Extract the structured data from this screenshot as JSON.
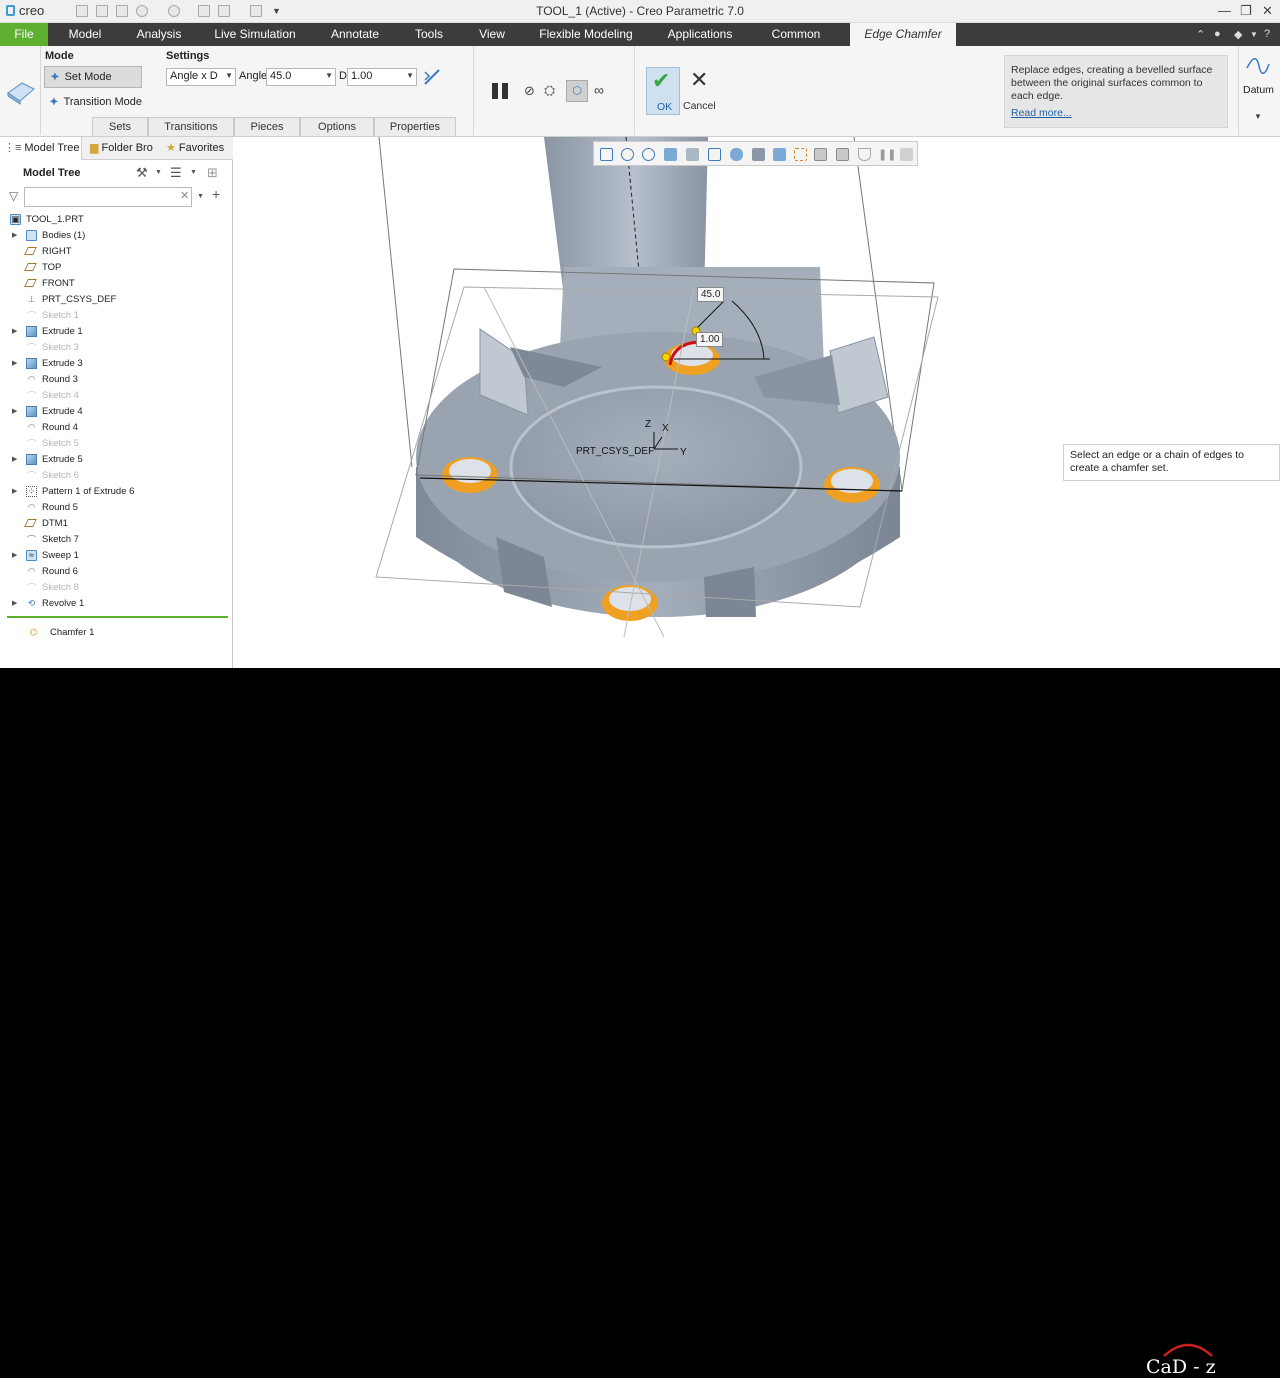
{
  "titlebar": {
    "logo": "creo",
    "title": "TOOL_1 (Active) - Creo Parametric 7.0"
  },
  "ribbon_tabs": [
    "File",
    "Model",
    "Analysis",
    "Live Simulation",
    "Annotate",
    "Tools",
    "View",
    "Flexible Modeling",
    "Applications",
    "Common",
    "Edge Chamfer"
  ],
  "ribbon": {
    "mode_label": "Mode",
    "settings_label": "Settings",
    "set_mode": "Set Mode",
    "transition_mode": "Transition Mode",
    "dim_scheme": "Angle x D",
    "angle_label": "Angle",
    "angle_value": "45.0",
    "d_label": "D",
    "d_value": "1.00",
    "ok_label": "OK",
    "cancel_label": "Cancel",
    "subtabs": [
      "Sets",
      "Transitions",
      "Pieces",
      "Options",
      "Properties"
    ],
    "help_text": "Replace edges, creating a bevelled surface between the original surfaces common to each edge.",
    "read_more": "Read more...",
    "datum_label": "Datum"
  },
  "left_panel": {
    "tabs": [
      "Model Tree",
      "Folder Bro",
      "Favorites"
    ],
    "header": "Model Tree",
    "tree": [
      {
        "label": "TOOL_1.PRT",
        "icon": "part-icon",
        "dim": false,
        "expand": false
      },
      {
        "label": "Bodies (1)",
        "icon": "body-icon",
        "dim": false,
        "expand": true
      },
      {
        "label": "RIGHT",
        "icon": "datum-plane-icon",
        "dim": false,
        "expand": false
      },
      {
        "label": "TOP",
        "icon": "datum-plane-icon",
        "dim": false,
        "expand": false
      },
      {
        "label": "FRONT",
        "icon": "datum-plane-icon",
        "dim": false,
        "expand": false
      },
      {
        "label": "PRT_CSYS_DEF",
        "icon": "csys-icon",
        "dim": false,
        "expand": false
      },
      {
        "label": "Sketch 1",
        "icon": "sketch-icon",
        "dim": true,
        "expand": false
      },
      {
        "label": "Extrude 1",
        "icon": "extrude-icon",
        "dim": false,
        "expand": true
      },
      {
        "label": "Sketch 3",
        "icon": "sketch-icon",
        "dim": true,
        "expand": false
      },
      {
        "label": "Extrude 3",
        "icon": "extrude-icon",
        "dim": false,
        "expand": true
      },
      {
        "label": "Round 3",
        "icon": "round-icon",
        "dim": false,
        "expand": false
      },
      {
        "label": "Sketch 4",
        "icon": "sketch-icon",
        "dim": true,
        "expand": false
      },
      {
        "label": "Extrude 4",
        "icon": "extrude-icon",
        "dim": false,
        "expand": true
      },
      {
        "label": "Round 4",
        "icon": "round-icon",
        "dim": false,
        "expand": false
      },
      {
        "label": "Sketch 5",
        "icon": "sketch-icon",
        "dim": true,
        "expand": false
      },
      {
        "label": "Extrude 5",
        "icon": "extrude-icon",
        "dim": false,
        "expand": true
      },
      {
        "label": "Sketch 6",
        "icon": "sketch-icon",
        "dim": true,
        "expand": false
      },
      {
        "label": "Pattern 1 of Extrude 6",
        "icon": "pattern-icon",
        "dim": false,
        "expand": true
      },
      {
        "label": "Round 5",
        "icon": "round-icon",
        "dim": false,
        "expand": false
      },
      {
        "label": "DTM1",
        "icon": "datum-plane-icon",
        "dim": false,
        "expand": false
      },
      {
        "label": "Sketch 7",
        "icon": "sketch-icon",
        "dim": false,
        "expand": false
      },
      {
        "label": "Sweep 1",
        "icon": "sweep-icon",
        "dim": false,
        "expand": true
      },
      {
        "label": "Round 6",
        "icon": "round-icon",
        "dim": false,
        "expand": false
      },
      {
        "label": "Sketch 8",
        "icon": "sketch-icon",
        "dim": true,
        "expand": false
      },
      {
        "label": "Revolve 1",
        "icon": "revolve-icon",
        "dim": false,
        "expand": true
      }
    ],
    "insert_item": "Chamfer 1"
  },
  "viewport": {
    "angle_dim": "45.0",
    "d_dim": "1.00",
    "csys_label": "PRT_CSYS_DEF",
    "axis_z": "Z",
    "axis_x": "X",
    "axis_y": "Y",
    "prompt": "Select an edge or a chain of edges to create a chamfer set."
  },
  "footer": {
    "brand": "CaD - z"
  },
  "colors": {
    "file_tab": "#5fb030",
    "ribbon_dark": "#3c3c3c",
    "chamfer_orange": "#f0a020",
    "ok_check": "#3aa745"
  }
}
